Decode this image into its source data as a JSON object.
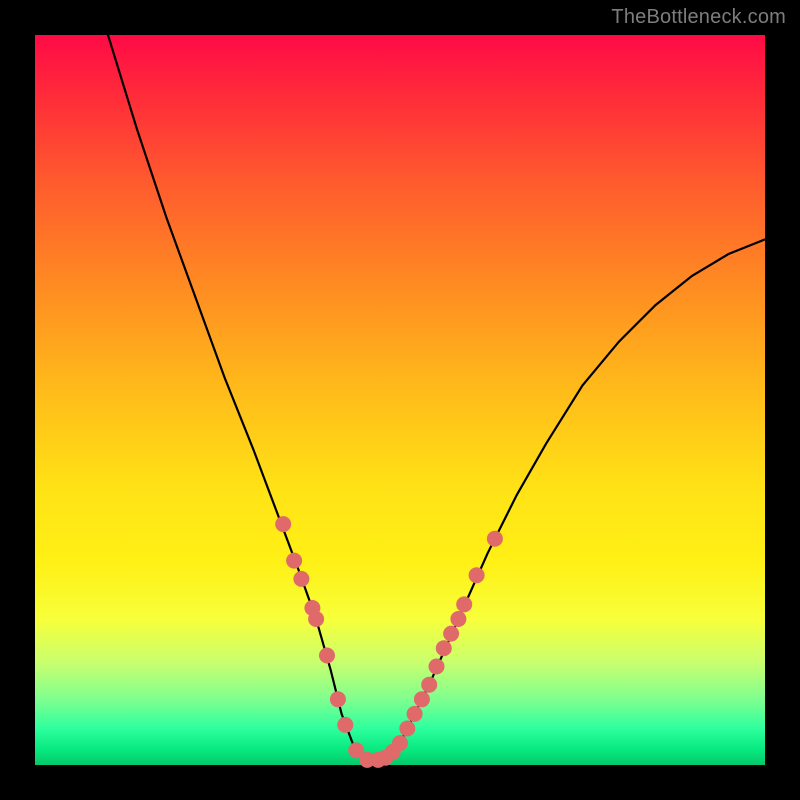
{
  "watermark": "TheBottleneck.com",
  "chart_data": {
    "type": "line",
    "title": "",
    "xlabel": "",
    "ylabel": "",
    "xlim": [
      0,
      100
    ],
    "ylim": [
      0,
      100
    ],
    "series": [
      {
        "name": "bottleneck-curve",
        "x": [
          10,
          14,
          18,
          22,
          26,
          30,
          33,
          36,
          38.5,
          40.5,
          42,
          43.5,
          45,
          46.5,
          48,
          50,
          54,
          58,
          62,
          66,
          70,
          75,
          80,
          85,
          90,
          95,
          100
        ],
        "values": [
          100,
          87,
          75,
          64,
          53,
          43,
          35,
          27,
          20,
          13,
          7,
          3,
          1,
          0.5,
          1,
          3,
          11,
          20,
          29,
          37,
          44,
          52,
          58,
          63,
          67,
          70,
          72
        ]
      }
    ],
    "markers": {
      "name": "highlight-points",
      "color": "#e06a6a",
      "radius": 8,
      "points": [
        {
          "x": 34.0,
          "y": 33.0
        },
        {
          "x": 35.5,
          "y": 28.0
        },
        {
          "x": 36.5,
          "y": 25.5
        },
        {
          "x": 38.0,
          "y": 21.5
        },
        {
          "x": 38.5,
          "y": 20.0
        },
        {
          "x": 40.0,
          "y": 15.0
        },
        {
          "x": 41.5,
          "y": 9.0
        },
        {
          "x": 42.5,
          "y": 5.5
        },
        {
          "x": 44.0,
          "y": 2.0
        },
        {
          "x": 45.5,
          "y": 0.7
        },
        {
          "x": 47.0,
          "y": 0.7
        },
        {
          "x": 48.0,
          "y": 1.0
        },
        {
          "x": 49.0,
          "y": 1.8
        },
        {
          "x": 50.0,
          "y": 3.0
        },
        {
          "x": 51.0,
          "y": 5.0
        },
        {
          "x": 52.0,
          "y": 7.0
        },
        {
          "x": 53.0,
          "y": 9.0
        },
        {
          "x": 54.0,
          "y": 11.0
        },
        {
          "x": 55.0,
          "y": 13.5
        },
        {
          "x": 56.0,
          "y": 16.0
        },
        {
          "x": 57.0,
          "y": 18.0
        },
        {
          "x": 58.0,
          "y": 20.0
        },
        {
          "x": 58.8,
          "y": 22.0
        },
        {
          "x": 60.5,
          "y": 26.0
        },
        {
          "x": 63.0,
          "y": 31.0
        }
      ]
    }
  }
}
